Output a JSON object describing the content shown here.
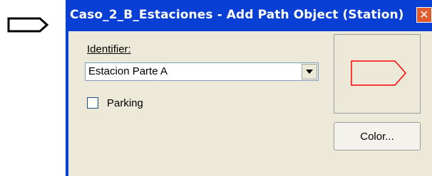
{
  "window": {
    "title": "Caso_2_B_Estaciones - Add Path Object (Station)",
    "close_glyph": "✕"
  },
  "form": {
    "identifier_label": "Identifier:",
    "identifier_value": "Estacion Parte A",
    "parking_label": "Parking",
    "parking_checked": false,
    "color_button_label": "Color..."
  },
  "icons": {
    "dropdown": "chevron-down-icon",
    "preview_shape": "station-shape-icon",
    "background_shape": "station-outline-icon"
  },
  "colors": {
    "title_bar": "#0a3fd6",
    "preview_stroke": "#ff0000",
    "dialog_face": "#ece9d8"
  }
}
